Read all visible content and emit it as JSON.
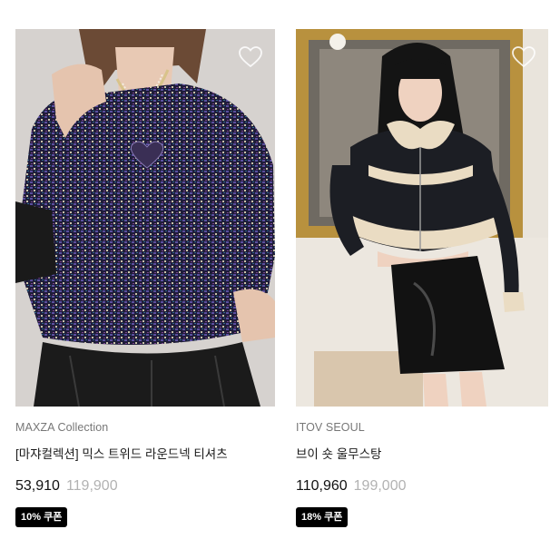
{
  "products": [
    {
      "brand": "MAXZA Collection",
      "title": "[마쟈컬렉션] 믹스 트위드 라운드넥 티셔츠",
      "price": "53,910",
      "original_price": "119,900",
      "coupon": "10% 쿠폰",
      "wishlist_icon": "heart-outline-icon"
    },
    {
      "brand": "ITOV SEOUL",
      "title": "브이 숏 울무스탕",
      "price": "110,960",
      "original_price": "199,000",
      "coupon": "18% 쿠폰",
      "wishlist_icon": "heart-outline-icon"
    }
  ],
  "colors": {
    "badge_bg": "#000000",
    "badge_text": "#ffffff",
    "brand_text": "#777777",
    "original_price_text": "#b2b2b2"
  }
}
